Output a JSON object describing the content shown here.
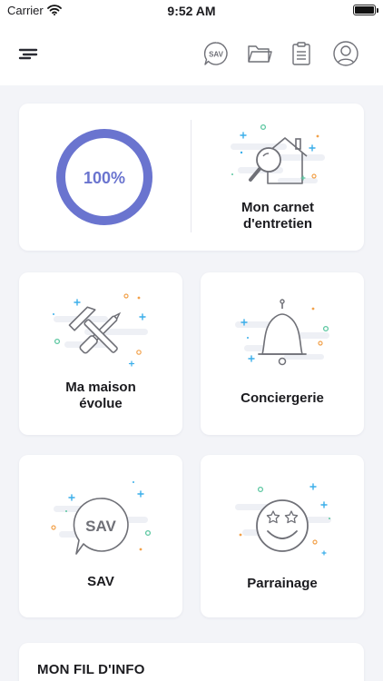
{
  "status_bar": {
    "carrier": "Carrier",
    "time": "9:52 AM"
  },
  "header": {
    "menu_icon": "menu-icon",
    "sav_icon_label": "SAV",
    "folder_icon": "folder-icon",
    "clipboard_icon": "clipboard-icon",
    "profile_icon": "user-icon"
  },
  "progress_card": {
    "progress_value": 100,
    "progress_text": "100%",
    "carnet_label_line1": "Mon carnet",
    "carnet_label_line2": "d'entretien",
    "icon": "house-search-icon"
  },
  "tiles": {
    "maison_line1": "Ma maison",
    "maison_line2": "évolue",
    "conciergerie": "Conciergerie",
    "sav": "SAV",
    "sav_icon_text": "SAV",
    "parrainage": "Parrainage"
  },
  "feed": {
    "title": "MON FIL D'INFO"
  },
  "colors": {
    "accent": "#6a74cf",
    "icon_stroke": "#6f7077",
    "sparkle_green": "#5cc7a1",
    "sparkle_orange": "#f2a14a",
    "sparkle_blue": "#3aaeea",
    "cloud": "#eef0f5"
  }
}
